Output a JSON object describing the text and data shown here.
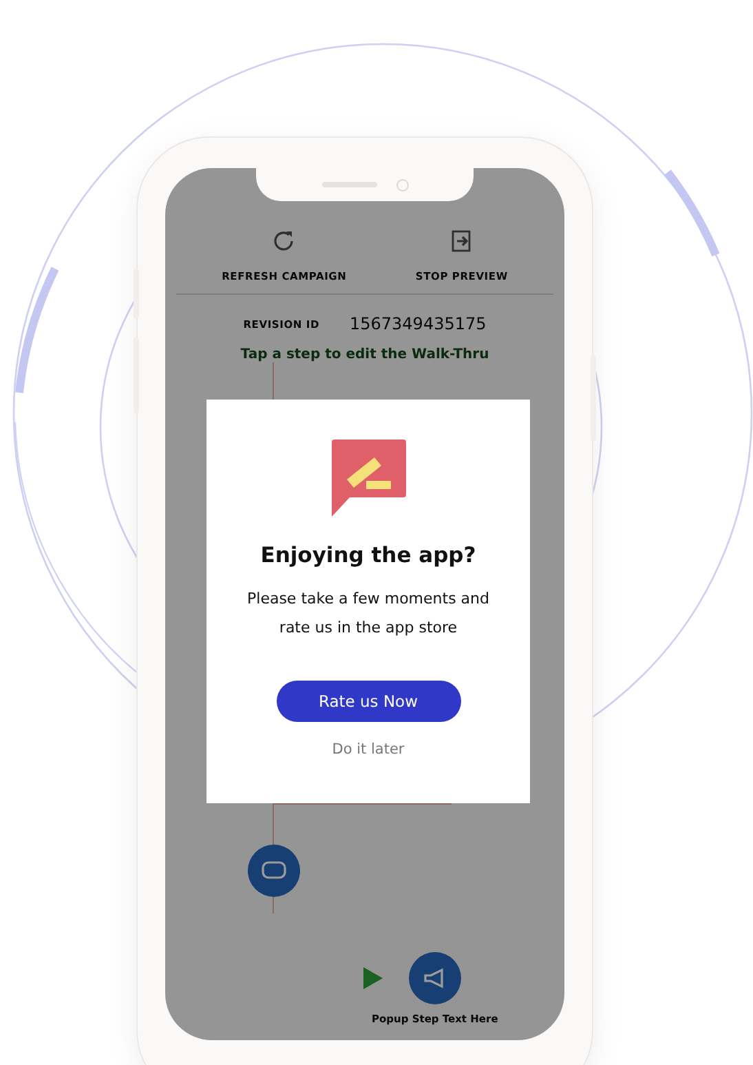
{
  "toolbar": [
    {
      "label": "REFRESH CAMPAIGN",
      "kind": "refresh"
    },
    {
      "label": "STOP PREVIEW",
      "kind": "stop"
    }
  ],
  "revision": {
    "label": "REVISION ID",
    "value": "1567349435175"
  },
  "hint": "Tap a step to edit the Walk-Thru",
  "steps": [
    {
      "kind": "chat"
    },
    {
      "kind": "popup",
      "label": "Popup Step Text Here"
    }
  ],
  "dialog": {
    "title": "Enjoying the app?",
    "message": "Please take a few moments and rate us in the app store",
    "primary_button": "Rate us Now",
    "secondary_button": "Do it later"
  }
}
